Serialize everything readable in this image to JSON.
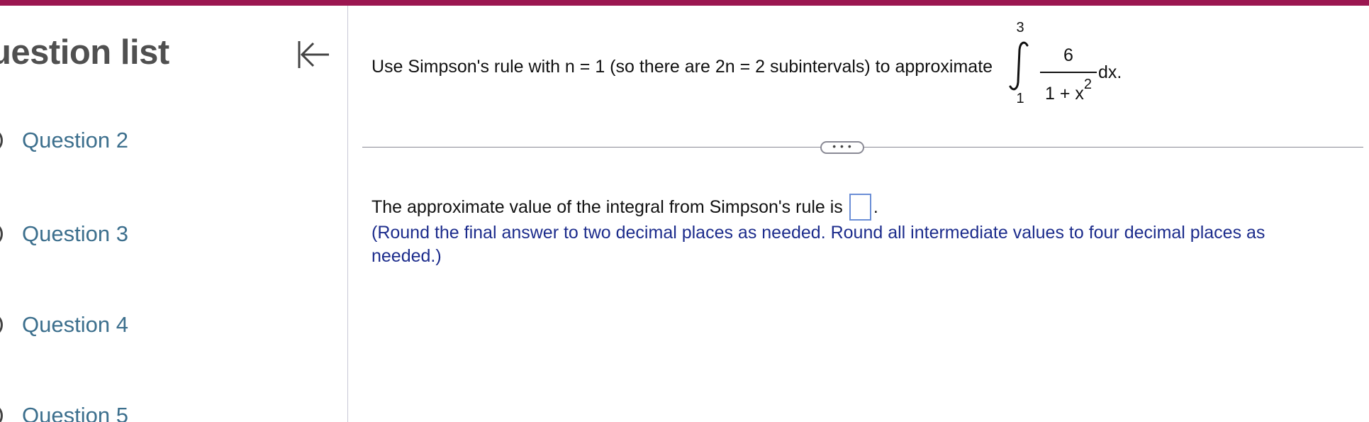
{
  "colors": {
    "top_bar": "#9b1650",
    "question_link": "#3c6f8d",
    "instruction_text": "#1c2c8c",
    "answer_box_border": "#6b8ed6"
  },
  "sidebar": {
    "title": "uestion list",
    "collapse_icon": "collapse-left-icon",
    "items": [
      {
        "label": "Question 2"
      },
      {
        "label": "Question 3"
      },
      {
        "label": "Question 4"
      },
      {
        "label": "Question 5"
      }
    ]
  },
  "question": {
    "prompt": "Use Simpson's rule with n = 1 (so there are 2n = 2 subintervals) to approximate",
    "integral": {
      "upper_limit": "3",
      "lower_limit": "1",
      "numerator": "6",
      "denominator_base": "1 + x",
      "denominator_exponent": "2",
      "differential": "dx."
    }
  },
  "more_button": {
    "label": "• • •"
  },
  "answer": {
    "text_before": "The approximate value of the integral from Simpson's rule is",
    "text_after": ".",
    "value": "",
    "instruction": "(Round the final answer to two decimal places as needed. Round all intermediate values to four decimal places as needed.)"
  }
}
